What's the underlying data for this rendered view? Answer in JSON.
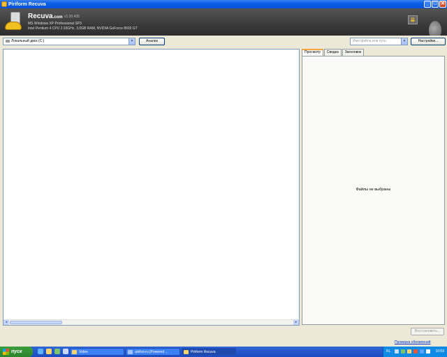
{
  "window": {
    "title": "Piriform Recuva",
    "buttons": {
      "minimize": "_",
      "maximize": "□",
      "close": "✕"
    }
  },
  "header": {
    "app_name": "Recuva",
    "app_suffix": ".com",
    "version": "v1.30.435",
    "os": "MS Windows XP Professional SP3",
    "hardware": "Intel Pentium 4 CPU 2.93GHz, 3,0GB RAM, NVIDIA GeForce 8600 GT",
    "menu_icon": "chevron-down-icon"
  },
  "toolbar": {
    "drive_value": "Локальный диск (C:)",
    "analyze_label": "Анализ",
    "path_placeholder": "Имя файла или путь",
    "settings_label": "Настройки..."
  },
  "preview": {
    "tabs": [
      {
        "label": "Просмотр",
        "active": true
      },
      {
        "label": "Сводка",
        "active": false
      },
      {
        "label": "Заголовок",
        "active": false
      }
    ],
    "empty_text": "Файлы не выбраны"
  },
  "bottom": {
    "recover_label": "Восстановить...",
    "check_updates": "Проверка обновлений"
  },
  "taskbar": {
    "start_label": "пуск",
    "tasks": [
      {
        "label": "Video",
        "active": false
      },
      {
        "label": "qrbhzi-ru [Powered ...",
        "active": false
      },
      {
        "label": "Piriform Recuva",
        "active": true
      }
    ],
    "tray": {
      "lang": "RL",
      "clock": "10:59"
    }
  },
  "colors": {
    "titlebar": "#0a5ee6",
    "header": "#3a3a3a",
    "accent_tab": "#f6a53a",
    "link": "#0033cc"
  }
}
